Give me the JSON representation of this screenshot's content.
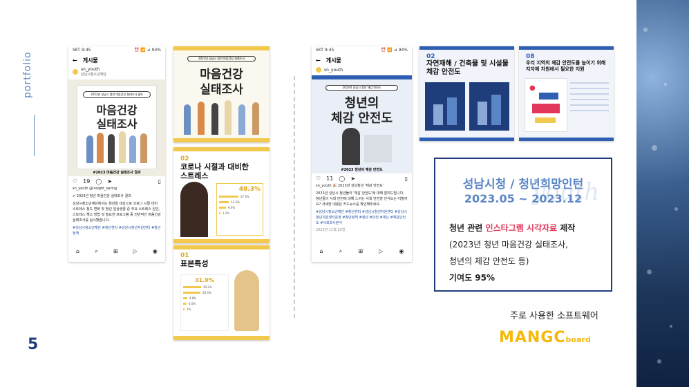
{
  "sidebar": {
    "label": "portfolio",
    "page_number": "5"
  },
  "colors": {
    "accent_blue": "#1f3d7a",
    "highlight_pink": "#e0375a",
    "poster_yellow": "#f2c94c",
    "logo_orange": "#f5b90a"
  },
  "ig_post_1": {
    "status_left": "SKT 9:45",
    "status_right": "⏰ 📶 ⊿ 94%",
    "header": "게시물",
    "username": "sn_youth",
    "user_sub": "성남시청소년재단",
    "poster_small": "2023년 성남시 청년 마음건강 실태조사 결과",
    "poster_title_1": "마음건강",
    "poster_title_2": "실태조사",
    "poster_footer": "#2023 마음건강 실태조사 결과",
    "likes": "19",
    "caption_handle": "sn_youth @insight_spring",
    "caption_lead": "✔ 2023년 청년 마음건강 실태조사 결과",
    "caption_body": "성남시청소년재단에서는 청년을 대상으로 코로나 시절 대비 스트레스 정도 변화 및 청년 일상생활 중 주요 스트레스 원인, 스트레스 해소 방법 및 필요한 프로그램 등 전반적인 마음건강 실태조사를 실시했습니다.",
    "hashtags": "#성남시청소년재단 #청년센터 #성남시청년지원센터 #청년정책"
  },
  "yellow_cards": {
    "c1": {
      "small": "2023년 성남시 청년 마음건강 실태조사",
      "title_1": "마음건강",
      "title_2": "실태조사"
    },
    "c2": {
      "num": "02",
      "title": "코로나 시절과 대비한 스트레스",
      "stat": "48.3%",
      "rows": [
        "27.6%",
        "13.3%",
        "9.6%",
        "1.2%"
      ]
    },
    "c3": {
      "num": "01",
      "title": "표본특성",
      "stat": "31.9%",
      "rows": [
        "29.2%",
        "28.4%",
        "4.8%",
        "4.0%",
        "1%"
      ]
    }
  },
  "ig_post_2": {
    "status_left": "SKT 9:45",
    "status_right": "⏰ 📶 ⊿ 94%",
    "header": "게시물",
    "username": "sn_youth",
    "poster_small": "2023년 성남시 청년 체감 안전도",
    "poster_title_1": "청년의",
    "poster_title_2": "체감 안전도",
    "poster_footer": "#2023 청년의 체감 안전도",
    "likes": "11",
    "caption_lead": "sn_youth 🎉 2023년 성남청년 '체감 안전도'",
    "caption_body": "2023년 성남시 청년들의 '체감 안전도'에 대해 알려드립니다. 청년들이 사회 안전에 대해 느끼는 사회 안전망 인식도는 어떨까요? 자세한 내용은 카드뉴스를 확인해주세요.",
    "hashtags": "#성남시청소년재단 #청년센터 #성남시청년지원센터 #성남시청년지원센터운영 #청년정책 #청년 #안전 #재난 #체감안전도 #사회조사분석",
    "date": "2023년 11월 23일"
  },
  "blue_cards": {
    "c1": {
      "num": "02",
      "title": "자연재해 / 건축물 및 시설물 체감 안전도"
    },
    "c2": {
      "num": "08",
      "title": "우리 지역의 체감 안전도를 높이기 위해 지자체 차원에서 필요한 지원"
    }
  },
  "info": {
    "title": "성남시청 / 청년희망인턴",
    "date": "2023.05 ~ 2023.12",
    "watermark": "youth",
    "line1_prefix": "청년 관련 ",
    "line1_highlight": "인스타그램 시각자료",
    "line1_suffix": " 제작",
    "line2": "(2023년 청년 마음건강 실태조사,",
    "line3": "청년의 체감 안전도 등)",
    "line4": "기여도 95%"
  },
  "software": {
    "label": "주로 사용한 소프트웨어",
    "logo_main": "MANGC",
    "logo_sub": "board"
  }
}
